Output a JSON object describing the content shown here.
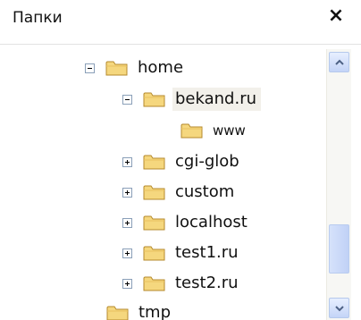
{
  "panel": {
    "title": "Папки",
    "close_label": "×"
  },
  "tree": {
    "items": [
      {
        "label": "home",
        "expander": "minus",
        "selected": false
      },
      {
        "label": "bekand.ru",
        "expander": "minus",
        "selected": true
      },
      {
        "label": "www",
        "expander": "none",
        "selected": false
      },
      {
        "label": "cgi-glob",
        "expander": "plus",
        "selected": false
      },
      {
        "label": "custom",
        "expander": "plus",
        "selected": false
      },
      {
        "label": "localhost",
        "expander": "plus",
        "selected": false
      },
      {
        "label": "test1.ru",
        "expander": "plus",
        "selected": false
      },
      {
        "label": "test2.ru",
        "expander": "plus",
        "selected": false
      },
      {
        "label": "tmp",
        "expander": "none",
        "selected": false
      }
    ]
  },
  "colors": {
    "folder_fill": "#f5d77e",
    "folder_stroke": "#b58a2c",
    "selection": "#f2f0ea",
    "scrollbar_button": "#c4d4f7"
  },
  "icons": {
    "folder": "folder-icon",
    "scroll_up": "scroll-up-arrow-icon",
    "scroll_down": "scroll-down-arrow-icon"
  }
}
